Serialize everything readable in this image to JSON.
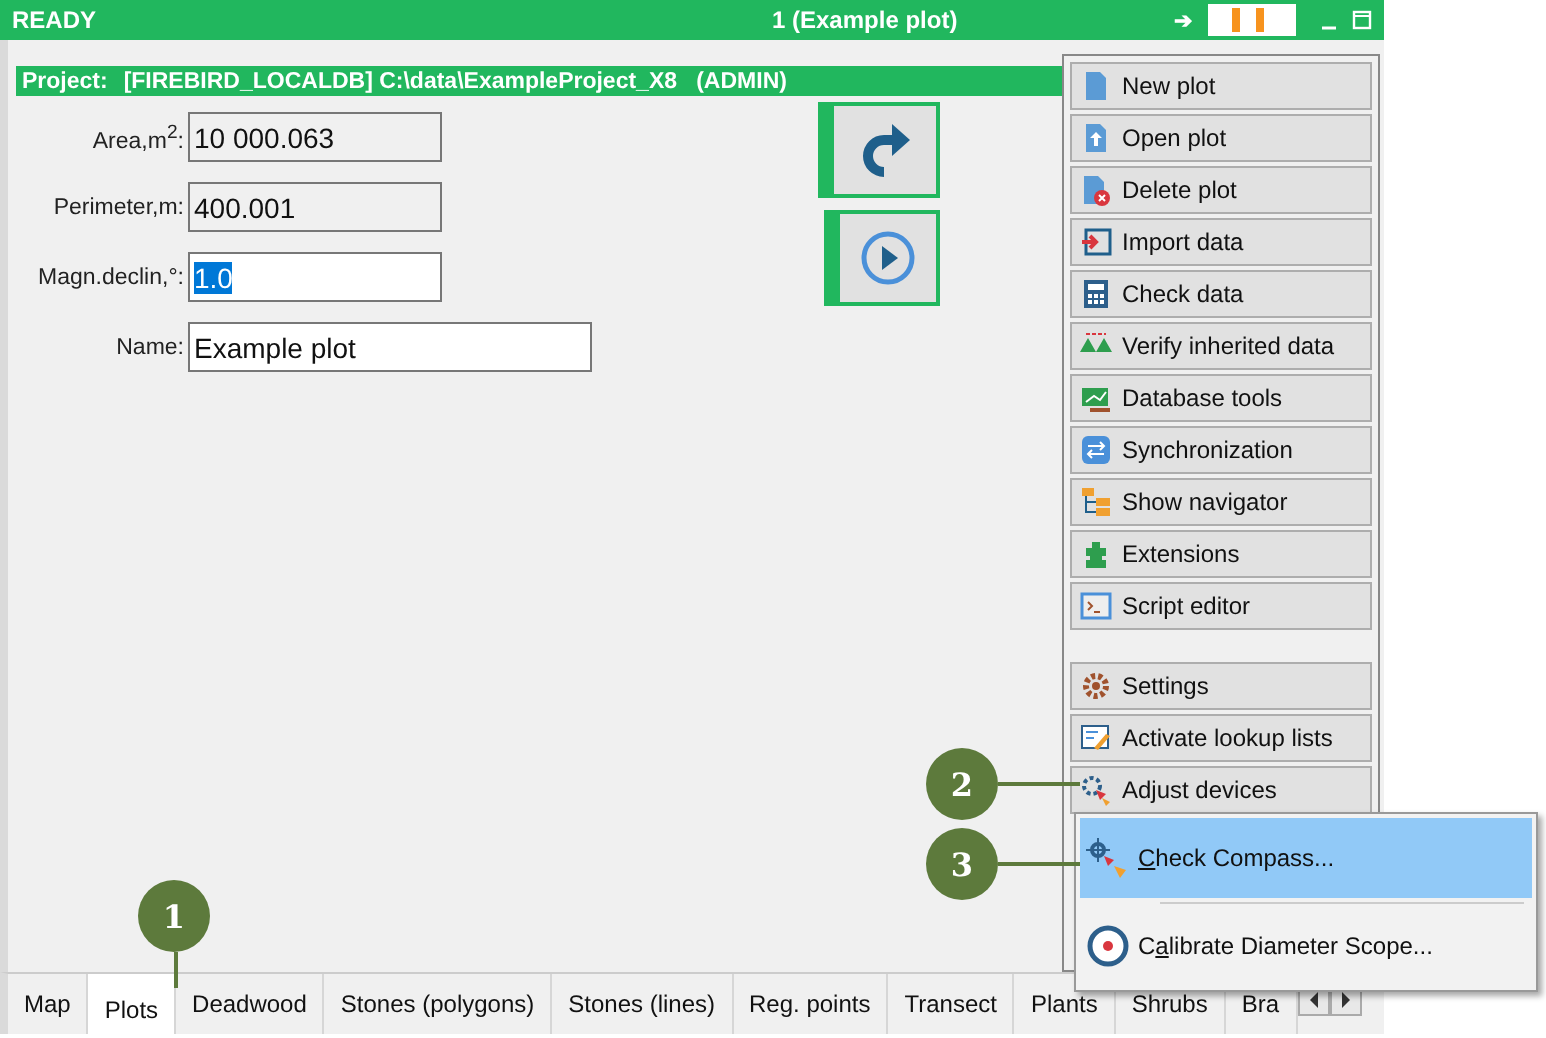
{
  "title_bar": {
    "status": "READY",
    "title": "1 (Example plot)",
    "arrow": "➔"
  },
  "project_bar": {
    "label": "Project:",
    "value": "[FIREBIRD_LOCALDB] C:\\data\\ExampleProject_X8   (ADMIN)"
  },
  "fields": [
    {
      "label": "Area,m$^{2}$:",
      "value": "10 000.063",
      "editable": false,
      "selected_text": false,
      "wide": false
    },
    {
      "label": "Perimeter,m:",
      "value": "400.001",
      "editable": false,
      "selected_text": false,
      "wide": false
    },
    {
      "label": "Magn.declin,°:",
      "value": "1.0",
      "editable": true,
      "selected_text": true,
      "wide": false
    },
    {
      "label": "Name:",
      "value": "Example plot",
      "editable": true,
      "selected_text": false,
      "wide": true
    }
  ],
  "panel_buttons": [
    {
      "label": "New plot"
    },
    {
      "label": "Open plot"
    },
    {
      "label": "Delete plot"
    },
    {
      "label": "Import data"
    },
    {
      "label": "Check data"
    },
    {
      "label": "Verify inherited data"
    },
    {
      "label": "Database tools"
    },
    {
      "label": "Synchronization"
    },
    {
      "label": "Show navigator"
    },
    {
      "label": "Extensions"
    },
    {
      "label": "Script editor"
    }
  ],
  "panel_buttons_bottom": [
    {
      "label": "Settings"
    },
    {
      "label": "Activate lookup lists"
    },
    {
      "label": "Adjust devices"
    }
  ],
  "popup_menu": [
    {
      "mnemonic": "C",
      "after": "heck Compass...",
      "selected": true
    },
    {
      "before": "C",
      "mnemonic": "a",
      "after": "librate Diameter Scope...",
      "selected": false
    }
  ],
  "tabs": [
    {
      "label": "Map",
      "selected": false
    },
    {
      "label": "Plots",
      "selected": true
    },
    {
      "label": "Deadwood",
      "selected": false
    },
    {
      "label": "Stones (polygons)",
      "selected": false
    },
    {
      "label": "Stones (lines)",
      "selected": false
    },
    {
      "label": "Reg. points",
      "selected": false
    },
    {
      "label": "Transect",
      "selected": false
    },
    {
      "label": "Plants",
      "selected": false
    },
    {
      "label": "Shrubs",
      "selected": false
    },
    {
      "label": "Bra",
      "selected": false
    }
  ],
  "callouts": [
    {
      "number": "1"
    },
    {
      "number": "2"
    },
    {
      "number": "3"
    }
  ]
}
